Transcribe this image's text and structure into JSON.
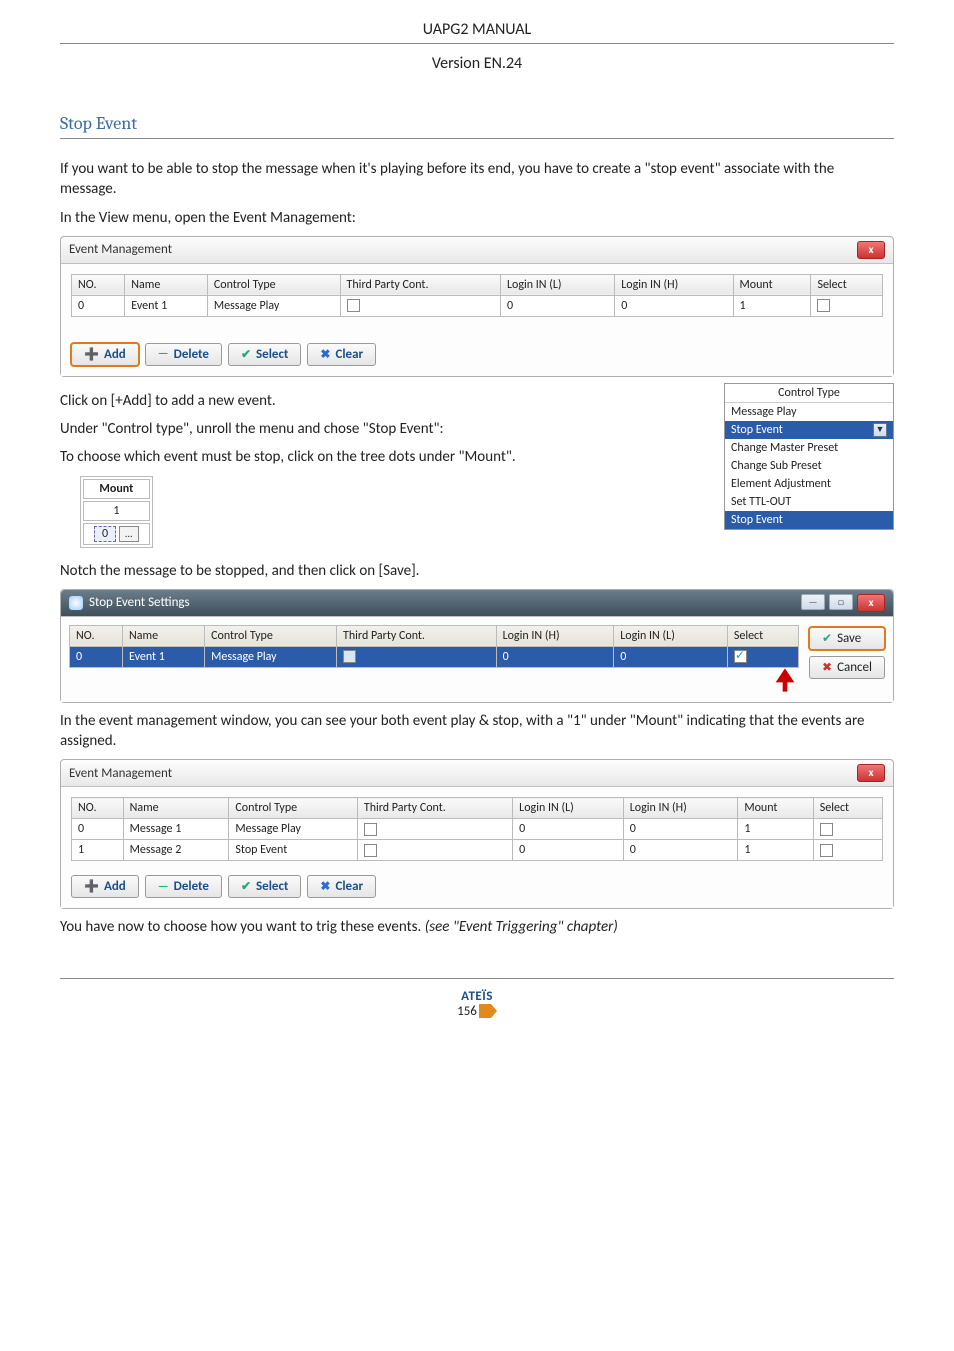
{
  "doc": {
    "title": "UAPG2  MANUAL",
    "version": "Version EN.24",
    "section_heading": "Stop Event",
    "p1": "If you want to be able to stop the message when it's playing before its end, you have to create a \"stop event\" associate with the message.",
    "p2": "In the View menu, open the Event Management:",
    "p3": "Click on [+Add] to add a new event.",
    "p4": "Under \"Control type\", unroll the menu and chose \"Stop Event\":",
    "p5": "To choose which event must be stop, click on the tree dots under \"Mount\".",
    "p6": "Notch the message to be stopped, and then click on [Save].",
    "p7": "In the event management window, you can see your both event play & stop, with a \"1\" under \"Mount\" indicating that the events are assigned.",
    "p8_a": "You have now to choose how you want to trig these events. ",
    "p8_b": "(see \"Event Triggering\" chapter)"
  },
  "em1": {
    "title": "Event Management",
    "close": "x",
    "columns": [
      "NO.",
      "Name",
      "Control Type",
      "Third Party Cont.",
      "Login IN (L)",
      "Login IN (H)",
      "Mount",
      "Select"
    ],
    "rows": [
      {
        "no": "0",
        "name": "Event 1",
        "ctype": "Message Play",
        "third": false,
        "l": "0",
        "h": "0",
        "mount": "1",
        "select": false
      }
    ],
    "btn_add": "Add",
    "btn_delete": "Delete",
    "btn_select": "Select",
    "btn_clear": "Clear"
  },
  "ct_menu": {
    "header": "Control Type",
    "current": "Message Play",
    "selected": "Stop Event",
    "items": [
      "Change Master Preset",
      "Change Sub Preset",
      "Element Adjustment",
      "Set TTL-OUT",
      "Stop Event"
    ]
  },
  "mount": {
    "header": "Mount",
    "row1": "1",
    "input": "0",
    "dots": "..."
  },
  "stop": {
    "title": "Stop Event Settings",
    "min": "—",
    "max": "□",
    "close": "x",
    "columns": [
      "NO.",
      "Name",
      "Control Type",
      "Third Party Cont.",
      "Login IN (H)",
      "Login IN (L)",
      "Select"
    ],
    "rows": [
      {
        "no": "0",
        "name": "Event 1",
        "ctype": "Message Play",
        "third": false,
        "h": "0",
        "l": "0",
        "select": true
      }
    ],
    "btn_save": "Save",
    "btn_cancel": "Cancel"
  },
  "em2": {
    "title": "Event Management",
    "close": "x",
    "columns": [
      "NO.",
      "Name",
      "Control Type",
      "Third Party Cont.",
      "Login IN (L)",
      "Login IN (H)",
      "Mount",
      "Select"
    ],
    "rows": [
      {
        "no": "0",
        "name": "Message 1",
        "ctype": "Message Play",
        "third": false,
        "l": "0",
        "h": "0",
        "mount": "1",
        "select": false
      },
      {
        "no": "1",
        "name": "Message 2",
        "ctype": "Stop Event",
        "third": false,
        "l": "0",
        "h": "0",
        "mount": "1",
        "select": false
      }
    ],
    "btn_add": "Add",
    "btn_delete": "Delete",
    "btn_select": "Select",
    "btn_clear": "Clear"
  },
  "footer": {
    "logo": "ATEÏS",
    "page": "156"
  },
  "colors": {
    "heading": "#3b6ba5",
    "link_blue": "#1b4f8a",
    "close_red": "#c33",
    "sel_blue": "#2a5caa",
    "arrow_red": "#c00"
  }
}
